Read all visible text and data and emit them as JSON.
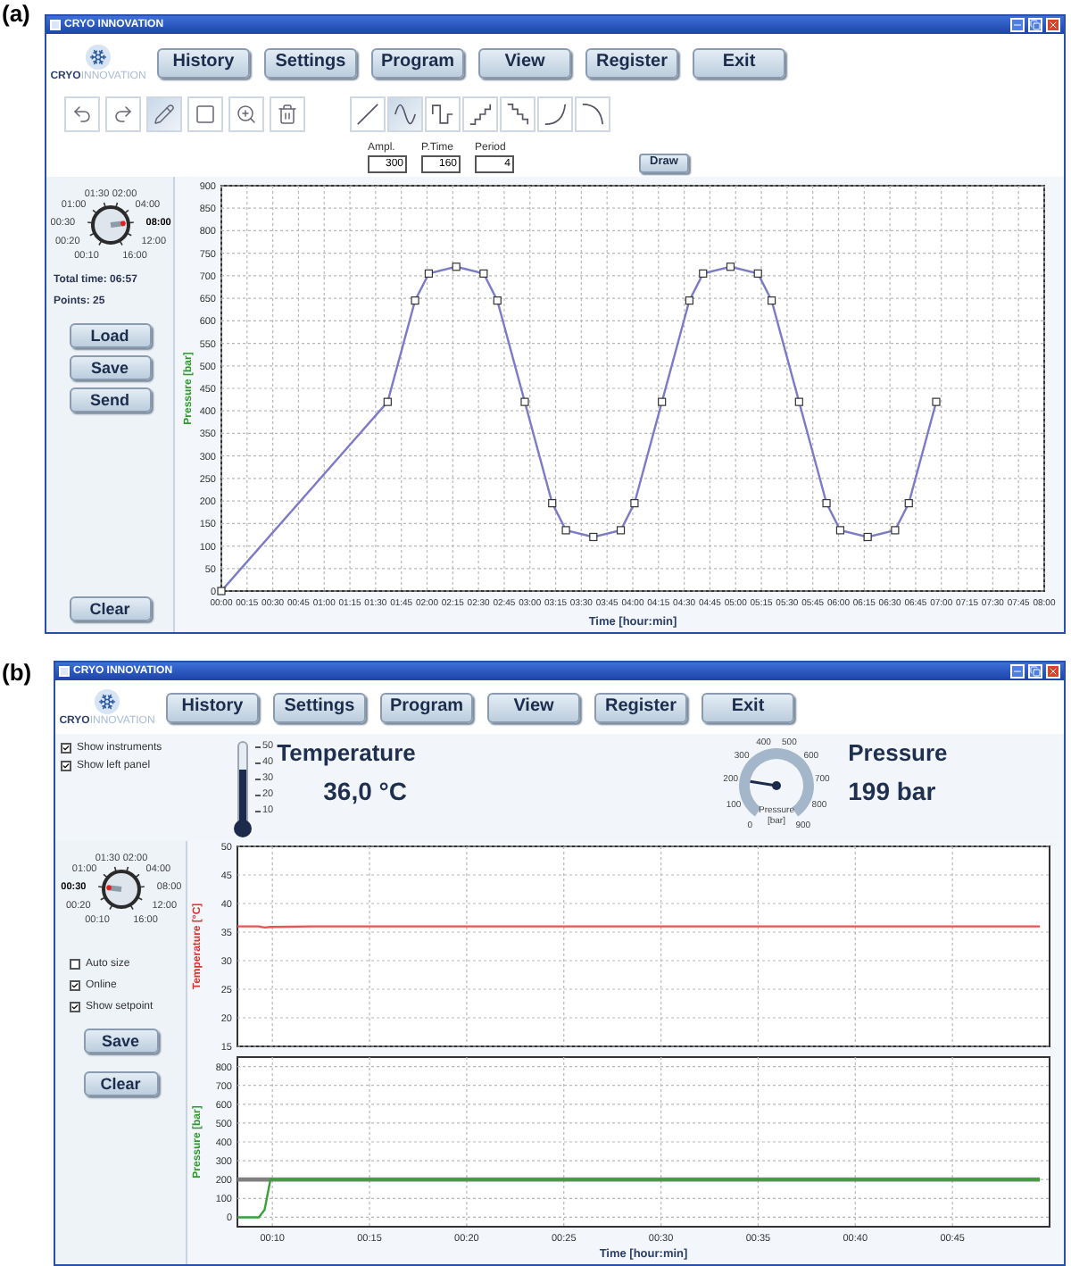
{
  "panels": [
    {
      "label": "(a)",
      "window": {
        "title": "CRYO INNOVATION",
        "logo": {
          "text_1": "CRYO",
          "text_2": "INNOVATION"
        },
        "nav": [
          "History",
          "Settings",
          "Program",
          "View",
          "Register",
          "Exit"
        ]
      },
      "toolbar": {
        "tools": [
          {
            "kind": "undo",
            "selected": false
          },
          {
            "kind": "redo",
            "selected": false
          },
          {
            "kind": "pencil",
            "selected": true
          },
          {
            "kind": "rectangle",
            "selected": false
          },
          {
            "kind": "zoom",
            "selected": false
          },
          {
            "kind": "trash",
            "selected": false
          }
        ],
        "shapes": [
          {
            "kind": "line",
            "selected": false
          },
          {
            "kind": "sine",
            "selected": true
          },
          {
            "kind": "square",
            "selected": false
          },
          {
            "kind": "step-up",
            "selected": false
          },
          {
            "kind": "step-down",
            "selected": false
          },
          {
            "kind": "curve-up",
            "selected": false
          },
          {
            "kind": "curve-down",
            "selected": false
          }
        ]
      },
      "params": {
        "fields": [
          {
            "label": "Ampl.",
            "value": "300"
          },
          {
            "label": "P.Time",
            "value": "160"
          },
          {
            "label": "Period",
            "value": "4"
          }
        ],
        "draw_button": "Draw"
      },
      "left_panel": {
        "dial": [
          {
            "label": "00:10",
            "selected": false
          },
          {
            "label": "00:20",
            "selected": false
          },
          {
            "label": "00:30",
            "selected": false
          },
          {
            "label": "01:00",
            "selected": false
          },
          {
            "label": "01:30",
            "selected": false
          },
          {
            "label": "02:00",
            "selected": false
          },
          {
            "label": "04:00",
            "selected": false
          },
          {
            "label": "08:00",
            "selected": true
          },
          {
            "label": "12:00",
            "selected": false
          },
          {
            "label": "16:00",
            "selected": false
          }
        ],
        "total_time": "Total time: 06:57",
        "points": "Points: 25",
        "buttons": [
          "Load",
          "Save",
          "Send"
        ],
        "clear_button": "Clear"
      },
      "chart": {
        "chart_data": {
          "type": "line",
          "xlabel": "Time [hour:min]",
          "ylabel": "Pressure [bar]",
          "grid": true,
          "xlim": [
            0,
            480
          ],
          "ylim": [
            0,
            900
          ],
          "x": [
            0,
            97,
            113,
            121,
            137,
            153,
            161,
            177,
            193,
            201,
            217,
            233,
            241,
            257,
            273,
            281,
            297,
            313,
            321,
            337,
            353,
            361,
            377,
            393,
            401,
            417
          ],
          "series": [
            {
              "color": "#7b7bc8",
              "marker": "square",
              "values": [
                0,
                420,
                645,
                705,
                720,
                705,
                645,
                420,
                195,
                135,
                120,
                135,
                195,
                420,
                645,
                705,
                720,
                705,
                645,
                420,
                195,
                135,
                120,
                135,
                195,
                420
              ]
            }
          ],
          "yticks": [
            0,
            50,
            100,
            150,
            200,
            250,
            300,
            350,
            400,
            450,
            500,
            550,
            600,
            650,
            700,
            750,
            800,
            850,
            900
          ],
          "xticks": [
            {
              "value": 0,
              "label": "00:00"
            },
            {
              "value": 15,
              "label": "00:15"
            },
            {
              "value": 30,
              "label": "00:30"
            },
            {
              "value": 45,
              "label": "00:45"
            },
            {
              "value": 60,
              "label": "01:00"
            },
            {
              "value": 75,
              "label": "01:15"
            },
            {
              "value": 90,
              "label": "01:30"
            },
            {
              "value": 105,
              "label": "01:45"
            },
            {
              "value": 120,
              "label": "02:00"
            },
            {
              "value": 135,
              "label": "02:15"
            },
            {
              "value": 150,
              "label": "02:30"
            },
            {
              "value": 165,
              "label": "02:45"
            },
            {
              "value": 180,
              "label": "03:00"
            },
            {
              "value": 195,
              "label": "03:15"
            },
            {
              "value": 210,
              "label": "03:30"
            },
            {
              "value": 225,
              "label": "03:45"
            },
            {
              "value": 240,
              "label": "04:00"
            },
            {
              "value": 255,
              "label": "04:15"
            },
            {
              "value": 270,
              "label": "04:30"
            },
            {
              "value": 285,
              "label": "04:45"
            },
            {
              "value": 300,
              "label": "05:00"
            },
            {
              "value": 315,
              "label": "05:15"
            },
            {
              "value": 330,
              "label": "05:30"
            },
            {
              "value": 345,
              "label": "05:45"
            },
            {
              "value": 360,
              "label": "06:00"
            },
            {
              "value": 375,
              "label": "06:15"
            },
            {
              "value": 390,
              "label": "06:30"
            },
            {
              "value": 405,
              "label": "06:45"
            },
            {
              "value": 420,
              "label": "07:00"
            },
            {
              "value": 435,
              "label": "07:15"
            },
            {
              "value": 450,
              "label": "07:30"
            },
            {
              "value": 465,
              "label": "07:45"
            },
            {
              "value": 480,
              "label": "08:00"
            }
          ]
        }
      }
    },
    {
      "label": "(b)",
      "window": {
        "title": "CRYO INNOVATION",
        "logo": {
          "text_1": "CRYO",
          "text_2": "INNOVATION"
        },
        "nav": [
          "History",
          "Settings",
          "Program",
          "View",
          "Register",
          "Exit"
        ]
      },
      "options": [
        {
          "label": "Show instruments",
          "checked": true
        },
        {
          "label": "Show left panel",
          "checked": true
        }
      ],
      "temperature": {
        "title": "Temperature",
        "reading": "36,0 °C",
        "scale": [
          "50",
          "40",
          "30",
          "20",
          "10"
        ],
        "level": 0.66
      },
      "pressure": {
        "title": "Pressure",
        "reading": "199 bar",
        "gauge_labels": [
          "0",
          "100",
          "200",
          "300",
          "400",
          "500",
          "600",
          "700",
          "800",
          "900"
        ],
        "gauge_caption": [
          "Pressure",
          "[bar]"
        ]
      },
      "left_panel": {
        "dial": [
          {
            "label": "00:10",
            "selected": false
          },
          {
            "label": "00:20",
            "selected": false
          },
          {
            "label": "00:30",
            "selected": true
          },
          {
            "label": "01:00",
            "selected": false
          },
          {
            "label": "01:30",
            "selected": false
          },
          {
            "label": "02:00",
            "selected": false
          },
          {
            "label": "04:00",
            "selected": false
          },
          {
            "label": "08:00",
            "selected": false
          },
          {
            "label": "12:00",
            "selected": false
          },
          {
            "label": "16:00",
            "selected": false
          }
        ],
        "options": [
          {
            "label": "Auto size",
            "checked": false
          },
          {
            "label": "Online",
            "checked": true
          },
          {
            "label": "Show setpoint",
            "checked": true
          }
        ],
        "buttons": [
          "Save",
          "Clear"
        ]
      },
      "charts": [
        {
          "chart_data": {
            "type": "line",
            "ylabel": "Temperature [°C]",
            "grid": true,
            "xlim": [
              8.2,
              50
            ],
            "ylim": [
              15,
              50
            ],
            "x": [
              8.2,
              9.3,
              9.6,
              9.9,
              12,
              25,
              35.5,
              49.5
            ],
            "series": [
              {
                "color": "#f05050",
                "values": [
                  36,
                  36,
                  35.8,
                  35.9,
                  36,
                  36,
                  36,
                  36
                ]
              }
            ],
            "yticks": [
              15,
              20,
              25,
              30,
              35,
              40,
              45,
              50
            ]
          }
        },
        {
          "chart_data": {
            "type": "line",
            "xlabel": "Time [hour:min]",
            "ylabel": "Pressure [bar]",
            "grid": true,
            "xlim": [
              8.2,
              50
            ],
            "ylim": [
              -50,
              850
            ],
            "x": [
              8.2,
              9.3,
              9.6,
              9.9,
              12,
              25,
              35.5,
              49.5
            ],
            "series": [
              {
                "color": "#808080",
                "values": [
                  200,
                  200,
                  200,
                  200,
                  200,
                  200,
                  200,
                  200
                ]
              },
              {
                "color": "#3aa03a",
                "values": [
                  0,
                  0,
                  40,
                  200,
                  200,
                  200,
                  200,
                  200
                ]
              }
            ],
            "yticks": [
              0,
              100,
              200,
              300,
              400,
              500,
              600,
              700,
              800
            ],
            "xticks": [
              {
                "value": 10,
                "label": "00:10"
              },
              {
                "value": 15,
                "label": "00:15"
              },
              {
                "value": 20,
                "label": "00:20"
              },
              {
                "value": 25,
                "label": "00:25"
              },
              {
                "value": 30,
                "label": "00:30"
              },
              {
                "value": 35,
                "label": "00:35"
              },
              {
                "value": 40,
                "label": "00:40"
              },
              {
                "value": 45,
                "label": "00:45"
              }
            ]
          }
        }
      ]
    }
  ]
}
